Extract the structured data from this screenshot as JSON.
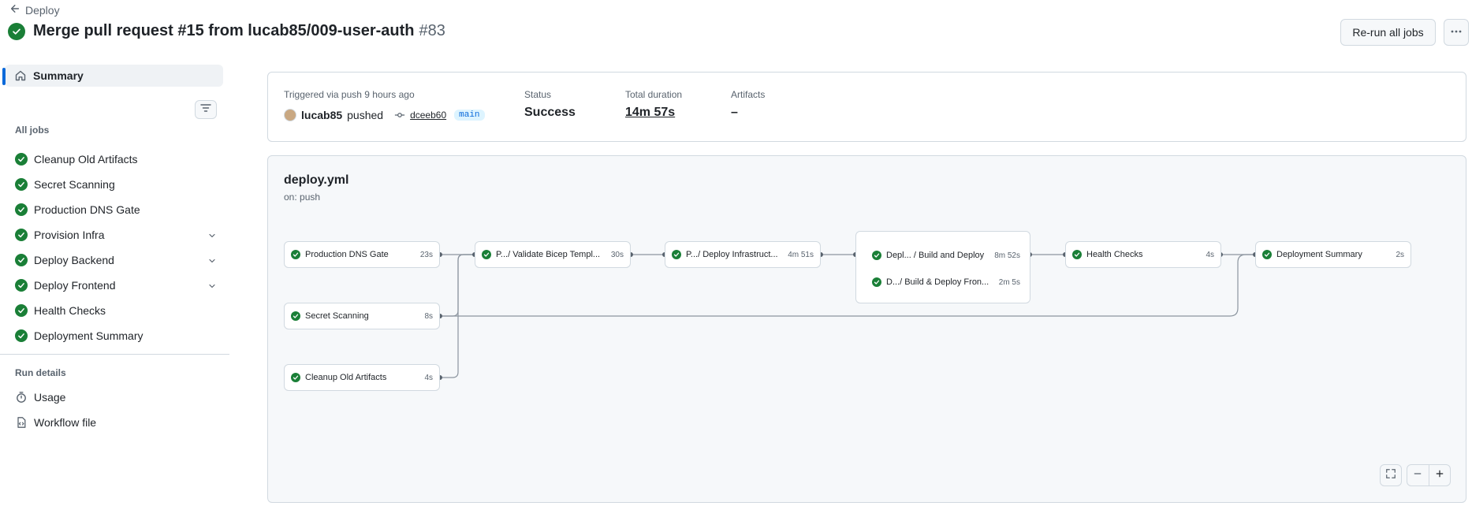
{
  "header": {
    "back_label": "Deploy",
    "title": "Merge pull request #15 from lucab85/009-user-auth",
    "run_number": "#83",
    "rerun_label": "Re-run all jobs"
  },
  "sidebar": {
    "summary_label": "Summary",
    "all_jobs_label": "All jobs",
    "jobs": [
      {
        "label": "Cleanup Old Artifacts"
      },
      {
        "label": "Secret Scanning"
      },
      {
        "label": "Production DNS Gate"
      },
      {
        "label": "Provision Infra"
      },
      {
        "label": "Deploy Backend"
      },
      {
        "label": "Deploy Frontend"
      },
      {
        "label": "Health Checks"
      },
      {
        "label": "Deployment Summary"
      }
    ],
    "run_details_label": "Run details",
    "usage_label": "Usage",
    "workflow_file_label": "Workflow file"
  },
  "summary": {
    "trigger_text": "Triggered via push 9 hours ago",
    "actor": "lucab85",
    "action": "pushed",
    "commit": "dceeb60",
    "branch": "main",
    "status_label": "Status",
    "status_value": "Success",
    "duration_label": "Total duration",
    "duration_value": "14m 57s",
    "artifacts_label": "Artifacts",
    "artifacts_value": "–"
  },
  "graph": {
    "file": "deploy.yml",
    "trigger": "on: push",
    "nodes": {
      "dns_gate": {
        "name": "Production DNS Gate",
        "duration": "23s"
      },
      "secret_scan": {
        "name": "Secret Scanning",
        "duration": "8s"
      },
      "cleanup": {
        "name": "Cleanup Old Artifacts",
        "duration": "4s"
      },
      "validate": {
        "name": "P.../ Validate Bicep Templ...",
        "duration": "30s"
      },
      "deploy_infra": {
        "name": "P.../ Deploy Infrastruct...",
        "duration": "4m 51s"
      },
      "build_deploy": {
        "name": "Depl... / Build and Deploy",
        "duration": "8m 52s"
      },
      "build_frontend": {
        "name": "D.../ Build & Deploy Fron...",
        "duration": "2m 5s"
      },
      "health": {
        "name": "Health Checks",
        "duration": "4s"
      },
      "summary": {
        "name": "Deployment Summary",
        "duration": "2s"
      }
    }
  },
  "colors": {
    "success": "#1a7f37",
    "accent": "#0969da",
    "border": "#d1d9e0"
  }
}
